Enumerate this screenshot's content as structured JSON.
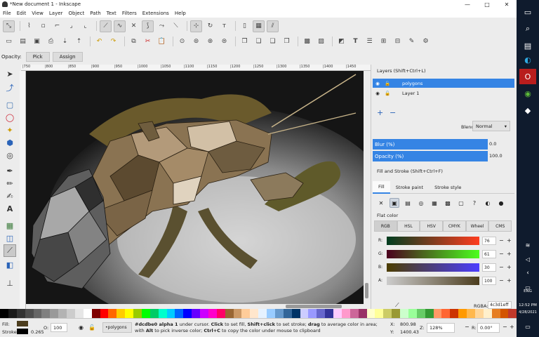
{
  "window": {
    "title": "*New document 1 - Inkscape",
    "minimize": "—",
    "maximize": "□",
    "close": "✕"
  },
  "menu": [
    "File",
    "Edit",
    "View",
    "Layer",
    "Object",
    "Path",
    "Text",
    "Filters",
    "Extensions",
    "Help"
  ],
  "opacity_label": "Opacity:",
  "pick_label": "Pick",
  "assign_label": "Assign",
  "ruler_top": [
    "|750",
    "|800",
    "|850",
    "|900",
    "|950",
    "|1000",
    "|1050",
    "|1100",
    "|1150",
    "|1200",
    "|1250",
    "|1300",
    "|1350",
    "|1400",
    "|1450"
  ],
  "layers": {
    "title": "Layers (Shift+Ctrl+L)",
    "rows": [
      {
        "name": "polygons",
        "selected": true
      },
      {
        "name": "Layer 1",
        "selected": false
      }
    ],
    "blend_label": "Blend mode:",
    "blend_value": "Normal",
    "blur_label": "Blur (%)",
    "blur_value": "0.0",
    "opacity_label": "Opacity (%)",
    "opacity_value": "100.0"
  },
  "fill_stroke": {
    "title": "Fill and Stroke (Shift+Ctrl+F)",
    "tabs": [
      "Fill",
      "Stroke paint",
      "Stroke style"
    ],
    "flat_color": "Flat color",
    "modes": [
      "RGB",
      "HSL",
      "HSV",
      "CMYK",
      "Wheel",
      "CMS"
    ],
    "channels": [
      {
        "label": "R:",
        "value": "76",
        "grad": "linear-gradient(90deg,#003d1f,#ff3d1f)"
      },
      {
        "label": "G:",
        "value": "61",
        "grad": "linear-gradient(90deg,#4c001f,#4cff1f)"
      },
      {
        "label": "B:",
        "value": "30",
        "grad": "linear-gradient(90deg,#4c3d00,#4c3dff)"
      },
      {
        "label": "A:",
        "value": "100",
        "grad": "linear-gradient(90deg,#cccccc,#4c3d1e)"
      }
    ],
    "rgba_label": "RGBA:",
    "rgba_value": "4c3d1eff"
  },
  "status": {
    "fill_label": "Fill:",
    "stroke_label": "Stroke:",
    "stroke_width": "0.265",
    "o_label": "O:",
    "o_value": "100",
    "layer_select": "•polygons",
    "message_html_parts": {
      "a": "#dcdbe0 alpha 1",
      "b": " under cursor. ",
      "c": "Click",
      "d": " to set fill, ",
      "e": "Shift+click",
      "f": " to set stroke; ",
      "g": "drag",
      "h": " to average color in area; with ",
      "i": "Alt",
      "j": " to pick inverse color; ",
      "k": "Ctrl+C",
      "l": " to copy the color under mouse to clipboard"
    },
    "x_label": "X:",
    "x_value": "800.98",
    "y_label": "Y:",
    "y_value": "1400.43",
    "zoom_label": "Z:",
    "zoom_value": "128%",
    "rot_label": "R:",
    "rot_value": "0.00°"
  },
  "taskbar": {
    "lang": "ENG",
    "time": "12:52 PM",
    "date": "4/28/2021"
  },
  "colors": {
    "accent": "#3584e4",
    "fill_swatch": "#4c3d1e",
    "stroke_swatch": "#000000"
  },
  "palette": [
    "#000000",
    "#1a1a1a",
    "#333333",
    "#4d4d4d",
    "#666666",
    "#808080",
    "#999999",
    "#b3b3b3",
    "#cccccc",
    "#e6e6e6",
    "#ffffff",
    "#800000",
    "#ff0000",
    "#ff6600",
    "#ffcc00",
    "#ffff00",
    "#99cc00",
    "#00ff00",
    "#00cc66",
    "#00ffcc",
    "#00ccff",
    "#0066ff",
    "#0000ff",
    "#6600ff",
    "#cc00ff",
    "#ff00cc",
    "#ff0066",
    "#996633",
    "#cc9966",
    "#ffcc99",
    "#ffe6cc",
    "#e6f2ff",
    "#99ccff",
    "#6699cc",
    "#336699",
    "#003366",
    "#ccccff",
    "#9999ff",
    "#6666cc",
    "#333399",
    "#ffccff",
    "#ff99cc",
    "#cc6699",
    "#993366",
    "#ffffcc",
    "#ffff99",
    "#cccc66",
    "#999933",
    "#ccffcc",
    "#99ff99",
    "#66cc66",
    "#339933",
    "#ff9966",
    "#ff6633",
    "#cc3300",
    "#ff9900",
    "#ffb84d",
    "#ffd699",
    "#fff0cc",
    "#e67e22",
    "#d35400",
    "#c0392b"
  ]
}
